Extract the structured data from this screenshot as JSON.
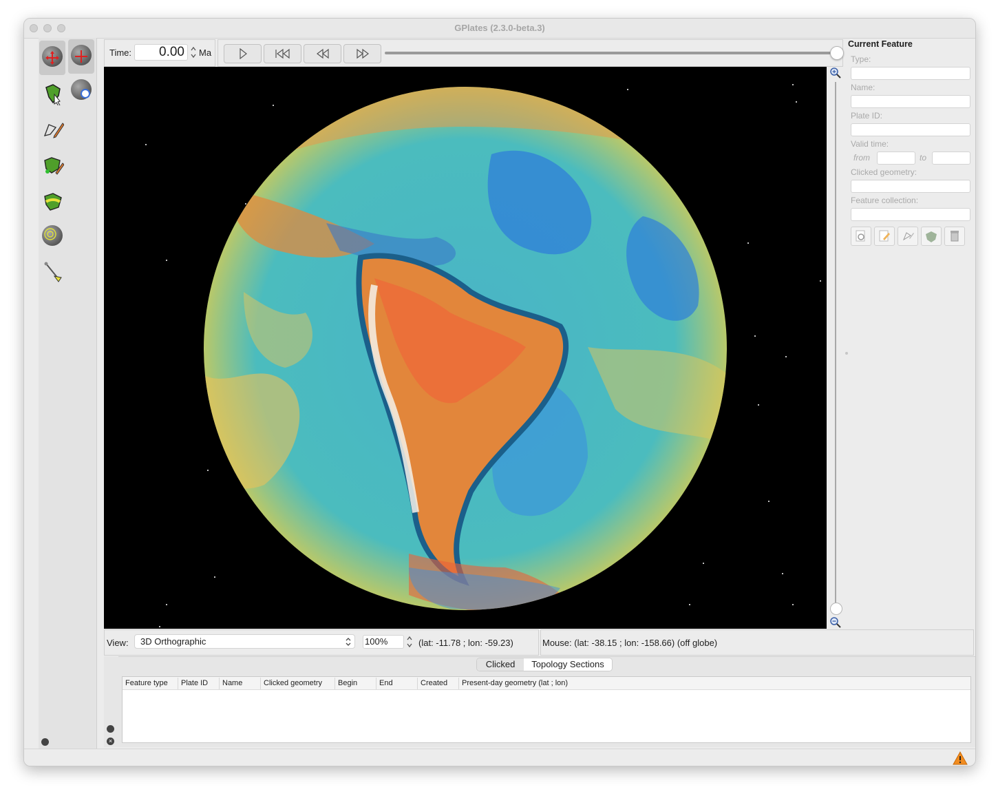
{
  "window": {
    "title": "GPlates (2.3.0-beta.3)"
  },
  "time_bar": {
    "label": "Time:",
    "value": "0.00",
    "unit": "Ma"
  },
  "playback": {
    "play": "play-icon",
    "reset": "skip-to-start-icon",
    "back": "rewind-icon",
    "forward": "fast-forward-icon",
    "slider_fraction": 1.0
  },
  "toolbar": {
    "primary": [
      "drag-globe",
      "choose-feature",
      "digitise-geometry",
      "edit-topology",
      "build-topology",
      "small-circle",
      "measure-distance"
    ],
    "secondary": [
      "drag-globe",
      "zoom-globe"
    ]
  },
  "current_feature": {
    "heading": "Current Feature",
    "type_label": "Type:",
    "name_label": "Name:",
    "plate_id_label": "Plate ID:",
    "valid_time_label": "Valid time:",
    "from_label": "from",
    "to_label": "to",
    "clicked_geometry_label": "Clicked geometry:",
    "feature_collection_label": "Feature collection:",
    "actions": [
      "query-feature-icon",
      "edit-feature-icon",
      "move-vertex-icon",
      "reconstruct-icon",
      "delete-icon"
    ]
  },
  "view_bar": {
    "view_label": "View:",
    "projection": "3D Orthographic",
    "zoom": "100%",
    "camera_coords": "(lat: -11.78 ; lon: -59.23)",
    "mouse_coords": "Mouse: (lat: -38.15 ; lon: -158.66) (off globe)"
  },
  "bottom_panel": {
    "tabs": [
      "Clicked",
      "Topology Sections"
    ],
    "active_tab": "Topology Sections",
    "columns": [
      "Feature type",
      "Plate ID",
      "Name",
      "Clicked geometry",
      "Begin",
      "End",
      "Created",
      "Present-day geometry (lat ; lon)"
    ]
  },
  "colors": {
    "globe_ocean": "#3aa9c8",
    "warm": "#e8763a",
    "accent_warning": "#f28c1f"
  }
}
